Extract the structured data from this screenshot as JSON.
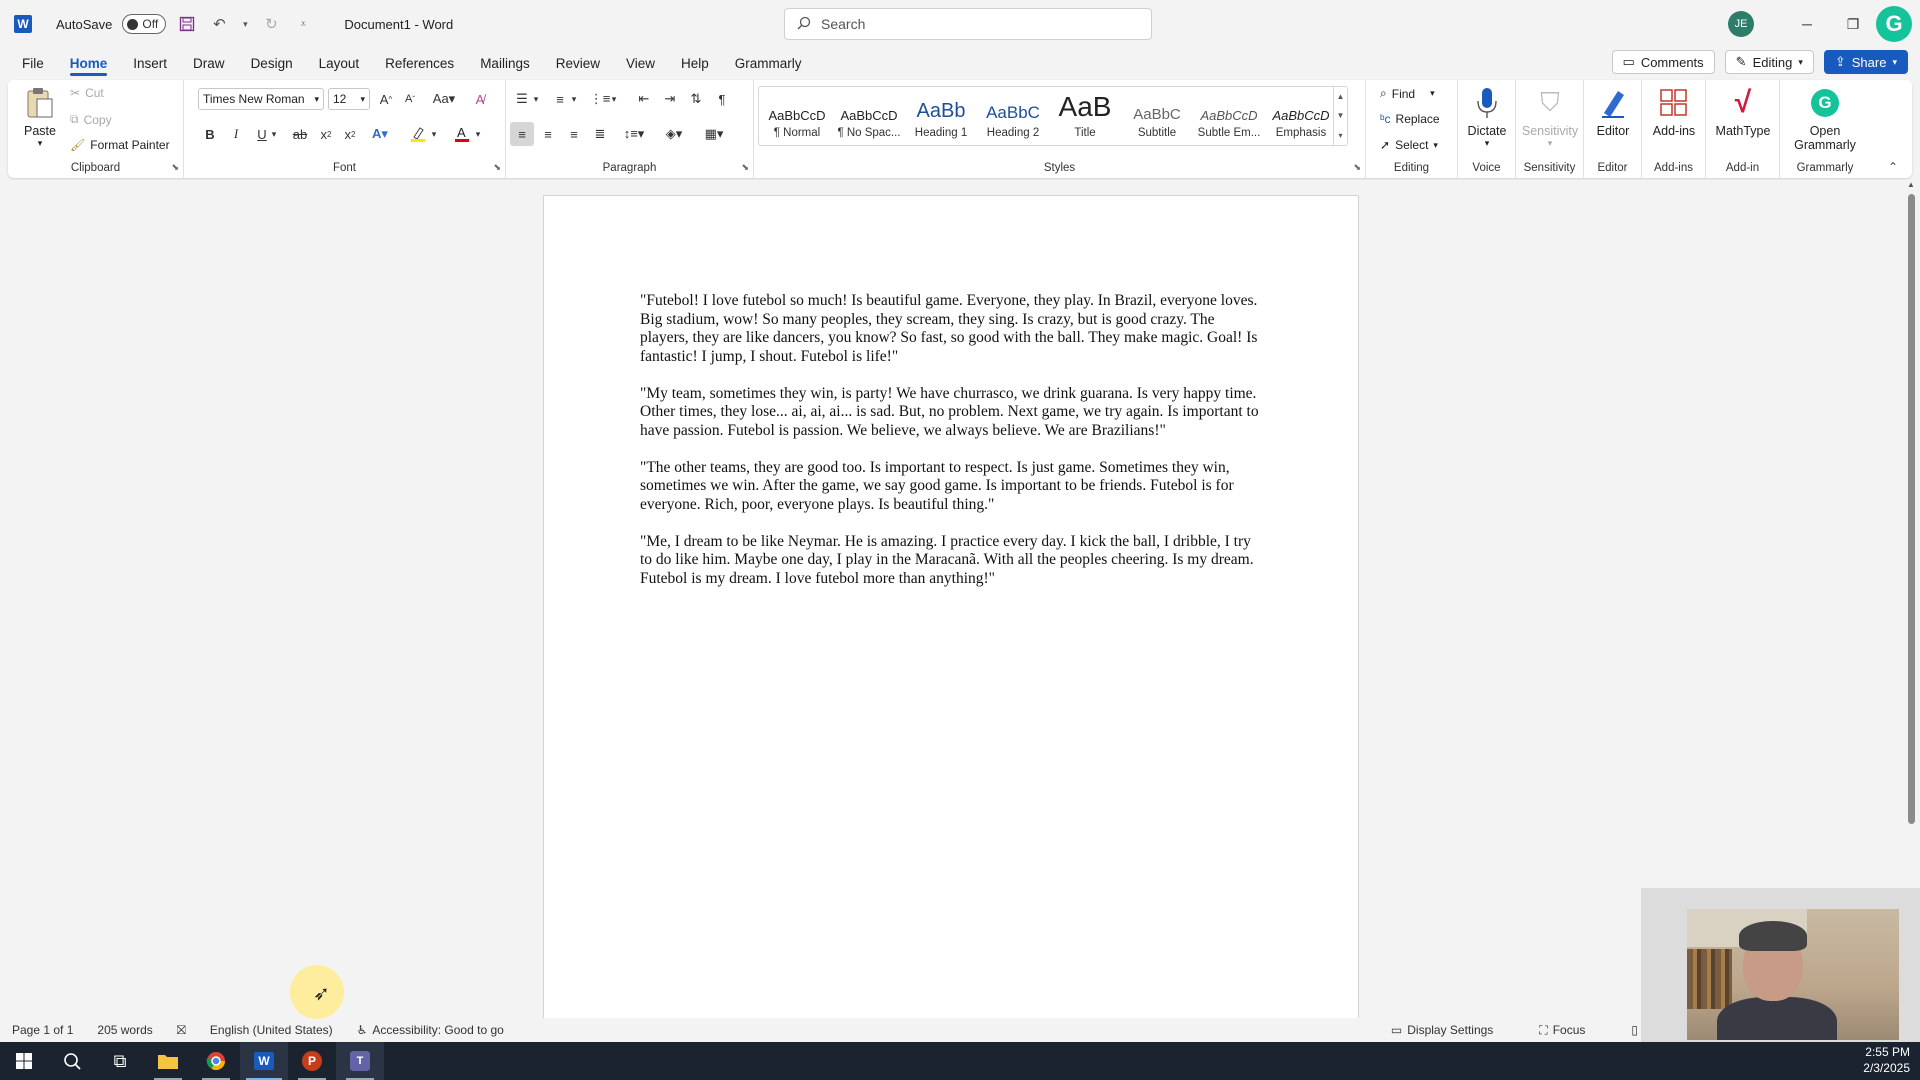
{
  "titlebar": {
    "autosave_label": "AutoSave",
    "autosave_state": "Off",
    "doc_title": "Document1  -  Word",
    "search_placeholder": "Search",
    "avatar_initials": "JE"
  },
  "menu": {
    "tabs": [
      "File",
      "Home",
      "Insert",
      "Draw",
      "Design",
      "Layout",
      "References",
      "Mailings",
      "Review",
      "View",
      "Help",
      "Grammarly"
    ],
    "active_tab": "Home",
    "comments_label": "Comments",
    "editing_label": "Editing",
    "share_label": "Share"
  },
  "ribbon": {
    "clipboard": {
      "label": "Clipboard",
      "paste": "Paste",
      "cut": "Cut",
      "copy": "Copy",
      "format_painter": "Format Painter"
    },
    "font": {
      "label": "Font",
      "font_name": "Times New Roman",
      "font_size": "12"
    },
    "paragraph": {
      "label": "Paragraph"
    },
    "styles": {
      "label": "Styles",
      "items": [
        {
          "preview": "AaBbCcD",
          "name": "¶ Normal"
        },
        {
          "preview": "AaBbCcD",
          "name": "¶ No Spac..."
        },
        {
          "preview": "AaBb",
          "name": "Heading 1"
        },
        {
          "preview": "AaBbC",
          "name": "Heading 2"
        },
        {
          "preview": "AaB",
          "name": "Title"
        },
        {
          "preview": "AaBbC",
          "name": "Subtitle"
        },
        {
          "preview": "AaBbCcD",
          "name": "Subtle Em..."
        },
        {
          "preview": "AaBbCcD",
          "name": "Emphasis"
        }
      ]
    },
    "editing": {
      "label": "Editing",
      "find": "Find",
      "replace": "Replace",
      "select": "Select"
    },
    "voice": {
      "label": "Voice",
      "dictate": "Dictate"
    },
    "sensitivity": {
      "label": "Sensitivity",
      "button": "Sensitivity"
    },
    "editor": {
      "label": "Editor",
      "button": "Editor"
    },
    "addins": {
      "label": "Add-ins",
      "button": "Add-ins"
    },
    "addin": {
      "label": "Add-in",
      "button": "MathType"
    },
    "grammarly": {
      "label": "Grammarly",
      "button_line1": "Open",
      "button_line2": "Grammarly"
    }
  },
  "document": {
    "paragraphs": [
      "\"Futebol! I love futebol so much! Is beautiful game. Everyone, they play. In Brazil, everyone loves. Big stadium, wow! So many peoples, they scream, they sing. Is crazy, but is good crazy. The players, they are like dancers, you know? So fast, so good with the ball. They make magic. Goal! Is fantastic! I jump, I shout. Futebol is life!\"",
      "\"My team, sometimes they win, is party! We have churrasco, we drink guarana. Is very happy time. Other times, they lose... ai, ai, ai... is sad. But, no problem. Next game, we try again. Is important to have passion. Futebol is passion. We believe, we always believe. We are Brazilians!\"",
      "\"The other teams, they are good too. Is important to respect. Is just game. Sometimes they win, sometimes we win. After the game, we say good game. Is important to be friends. Futebol is for everyone. Rich, poor, everyone plays. Is beautiful thing.\"",
      "\"Me, I dream to be like Neymar. He is amazing. I practice every day. I kick the ball, I dribble, I try to do like him. Maybe one day, I play in the Maracanã. With all the peoples cheering. Is my dream. Futebol is my dream. I love futebol more than anything!\""
    ]
  },
  "statusbar": {
    "page": "Page 1 of 1",
    "words": "205 words",
    "language": "English (United States)",
    "accessibility": "Accessibility: Good to go",
    "display_settings": "Display Settings",
    "focus": "Focus"
  },
  "taskbar": {
    "time": "2:55 PM",
    "date": "2/3/2025"
  },
  "colors": {
    "accent": "#185abd",
    "grammarly": "#15c39a",
    "taskbar": "#1b2330"
  }
}
